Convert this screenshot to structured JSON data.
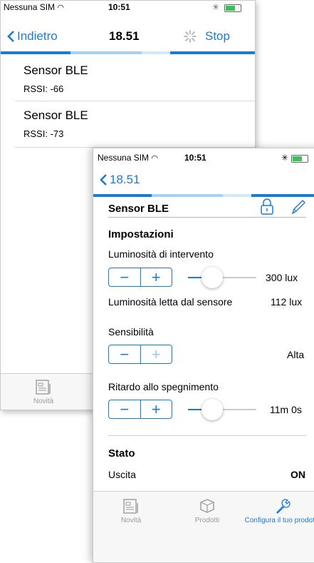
{
  "back": {
    "status": {
      "carrier": "Nessuna SIM",
      "time": "10:51"
    },
    "nav": {
      "back_label": "Indietro",
      "title": "18.51",
      "stop_label": "Stop"
    },
    "devices": [
      {
        "name": "Sensor BLE",
        "rssi": "RSSI: -66"
      },
      {
        "name": "Sensor BLE",
        "rssi": "RSSI: -73"
      }
    ],
    "tabs": {
      "news": "Novità"
    }
  },
  "front": {
    "status": {
      "carrier": "Nessuna SIM",
      "time": "10:51"
    },
    "nav": {
      "back_label": "18.51"
    },
    "device_name": "Sensor BLE",
    "settings_header": "Impostazioni",
    "threshold": {
      "label": "Luminosità di intervento",
      "value": "300 lux",
      "level": 0.35
    },
    "read_lux": {
      "label": "Luminosità letta dal sensore",
      "value": "112 lux"
    },
    "sensitivity": {
      "label": "Sensibilità",
      "value": "Alta"
    },
    "delay": {
      "label": "Ritardo allo spegnimento",
      "value": "11m 0s",
      "level": 0.35
    },
    "state_header": "Stato",
    "output": {
      "label": "Uscita",
      "value": "ON"
    },
    "tabs": {
      "news": "Novità",
      "products": "Prodotti",
      "configure": "Configura il tuo prodotto"
    }
  },
  "colors": {
    "accent": "#1a7ad4",
    "accent_light": "#9cc5ec"
  }
}
